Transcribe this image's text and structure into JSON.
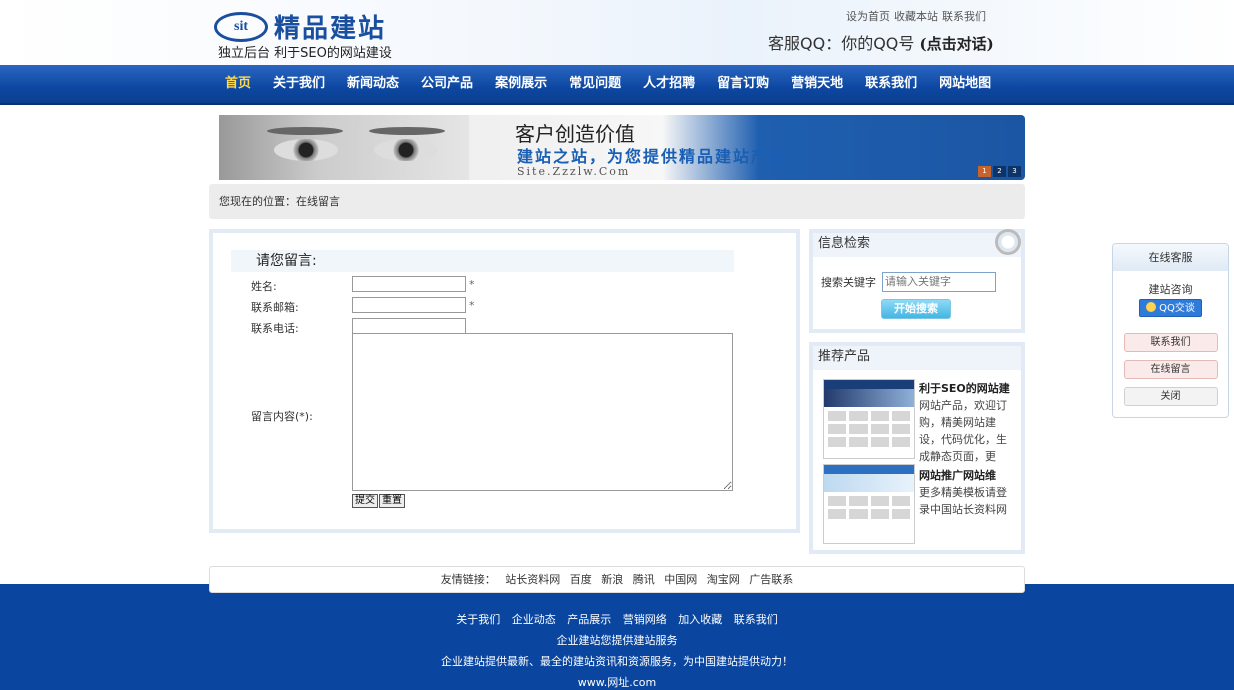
{
  "header": {
    "logo_mark": "sit",
    "logo_name": "精品建站",
    "slogan": "独立后台 利于SEO的网站建设",
    "top_links": [
      "设为首页",
      "收藏本站",
      "联系我们"
    ],
    "kefu_label": "客服QQ：你的QQ号",
    "kefu_link": "(点击对话)"
  },
  "nav": [
    "首页",
    "关于我们",
    "新闻动态",
    "公司产品",
    "案例展示",
    "常见问题",
    "人才招聘",
    "留言订购",
    "营销天地",
    "联系我们",
    "网站地图"
  ],
  "banner": {
    "line1": "客户创造价值",
    "line2": "建站之站，为您提供精品建站产品",
    "line3": "Site.Zzzlw.Com",
    "pages": [
      "1",
      "2",
      "3"
    ]
  },
  "breadcrumb": "您现在的位置：在线留言",
  "form": {
    "title": "请您留言:",
    "name_label": "姓名:",
    "email_label": "联系邮箱:",
    "phone_label": "联系电话:",
    "content_label": "留言内容(*):",
    "required_mark": "*",
    "submit_label": "提交",
    "reset_label": "重置"
  },
  "search": {
    "title": "信息检索",
    "label": "搜索关键字",
    "placeholder": "请输入关键字",
    "button": "开始搜索"
  },
  "products": {
    "title": "推荐产品",
    "items": [
      {
        "title": "利于SEO的网站建",
        "desc": "网站产品，欢迎订购，精美网站建设，代码优化，生成静态页面，更"
      },
      {
        "title": "网站推广网站维",
        "desc": "更多精美模板请登录中国站长资料网"
      }
    ]
  },
  "friend_links": {
    "label": "友情链接：",
    "items": [
      "站长资料网",
      "百度",
      "新浪",
      "腾讯",
      "中国网",
      "淘宝网",
      "广告联系"
    ]
  },
  "footer": {
    "links": [
      "关于我们",
      "企业动态",
      "产品展示",
      "营销网络",
      "加入收藏",
      "联系我们"
    ],
    "line1": "企业建站您提供建站服务",
    "line2": "企业建站提供最新、最全的建站资讯和资源服务，为中国建站提供动力！",
    "line3": "www.网址.com"
  },
  "service": {
    "title": "在线客服",
    "sub": "建站咨询",
    "qq": "QQ交谈",
    "contact": "联系我们",
    "message": "在线留言",
    "close": "关闭"
  },
  "colors": {
    "nav_bg": "#0d47a1",
    "nav_active": "#ffd84d",
    "footer_bg": "#0a46a0",
    "search_btn": "#43b6e4"
  }
}
